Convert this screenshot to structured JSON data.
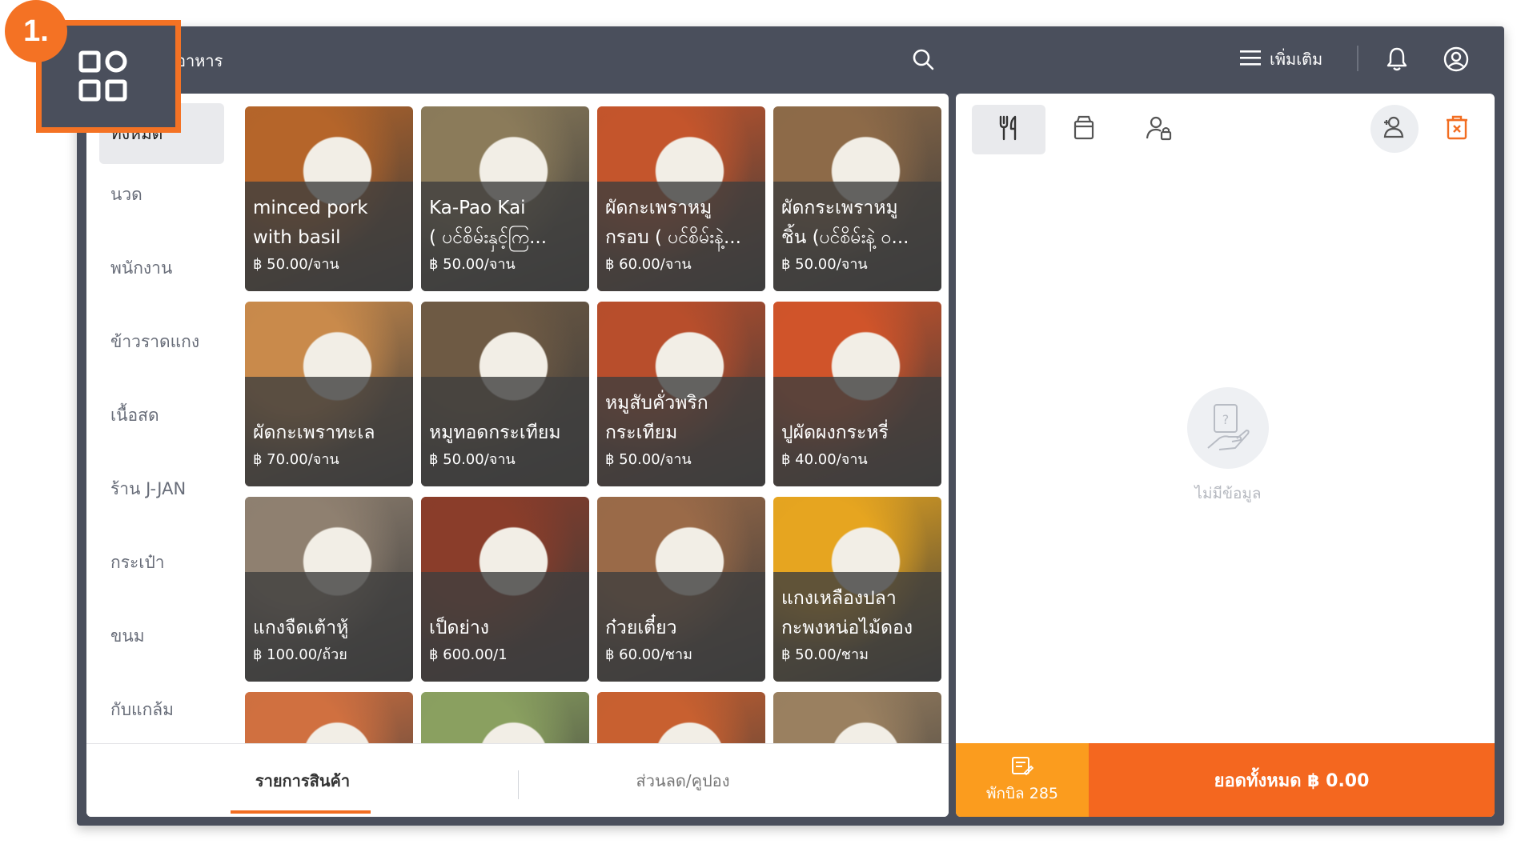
{
  "topbar": {
    "category_title": "อาหาร",
    "more_label": "เพิ่มเติม"
  },
  "step_badge": "1.",
  "sidebar": {
    "items": [
      {
        "label": "ทั้งหมด"
      },
      {
        "label": "นวด"
      },
      {
        "label": "พนักงาน"
      },
      {
        "label": "ข้าวราดแกง"
      },
      {
        "label": "เนื้อสด"
      },
      {
        "label": "ร้าน J-JAN"
      },
      {
        "label": "กระเป๋า"
      },
      {
        "label": "ขนม"
      },
      {
        "label": "กับแกล้ม"
      }
    ]
  },
  "products": [
    {
      "name1": "minced pork",
      "name2": "with basil",
      "price": "฿ 50.00/จาน",
      "color": "#b5652a"
    },
    {
      "name1": "Ka-Pao Kai",
      "name2": "( ပင်စိမ်းနှင့်ကြ...",
      "price": "฿ 50.00/จาน",
      "color": "#8b7b5a"
    },
    {
      "name1": "ผัดกะเพราหมู",
      "name2": "กรอบ ( ပင်စိမ်းနဲ့...",
      "price": "฿ 60.00/จาน",
      "color": "#c4552c"
    },
    {
      "name1": "ผัดกระเพราหมู",
      "name2": "ชิ้น (ပင်စိမ်းနဲ့ ဝ...",
      "price": "฿ 50.00/จาน",
      "color": "#8d6a48"
    },
    {
      "name1": "ผัดกะเพราทะเล",
      "name2": "",
      "price": "฿ 70.00/จาน",
      "color": "#c98a4b"
    },
    {
      "name1": "หมูทอดกระเทียม",
      "name2": "",
      "price": "฿ 50.00/จาน",
      "color": "#6e5a44"
    },
    {
      "name1": "หมูสับคั่วพริก",
      "name2": "กระเทียม",
      "price": "฿ 50.00/จาน",
      "color": "#b84e2c"
    },
    {
      "name1": "ปูผัดผงกระหรี่",
      "name2": "",
      "price": "฿ 40.00/จาน",
      "color": "#d0542a"
    },
    {
      "name1": "แกงจืดเต้าหู้",
      "name2": "",
      "price": "฿ 100.00/ถ้วย",
      "color": "#8f8070"
    },
    {
      "name1": "เป็ดย่าง",
      "name2": "",
      "price": "฿ 600.00/1",
      "color": "#8a3d2a"
    },
    {
      "name1": "ก๋วยเตี๋ยว",
      "name2": "",
      "price": "฿ 60.00/ชาม",
      "color": "#9a6a48"
    },
    {
      "name1": "แกงเหลืองปลา",
      "name2": "กะพงหน่อไม้ดอง",
      "price": "฿ 50.00/ชาม",
      "color": "#e6a520"
    },
    {
      "name1": "",
      "name2": "",
      "price": "",
      "color": "#d07040"
    },
    {
      "name1": "",
      "name2": "",
      "price": "",
      "color": "#8aa060"
    },
    {
      "name1": "",
      "name2": "",
      "price": "",
      "color": "#c86030"
    },
    {
      "name1": "",
      "name2": "",
      "price": "",
      "color": "#9a8060"
    }
  ],
  "bottom_tabs": {
    "products": "รายการสินค้า",
    "discount": "ส่วนลด/คูปอง"
  },
  "cart": {
    "empty_text": "ไม่มีข้อมูล",
    "hold_label": "พักบิล 285",
    "total_label": "ยอดทั้งหมด ฿ 0.00"
  }
}
